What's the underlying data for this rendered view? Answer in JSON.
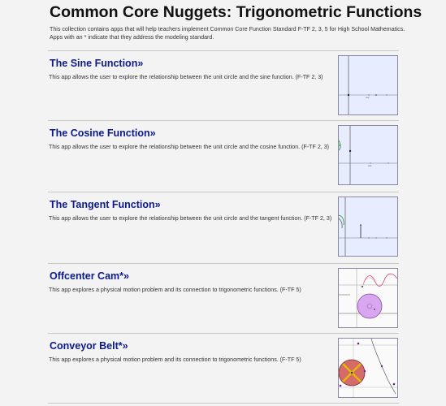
{
  "header": {
    "title": "Common Core Nuggets: Trigonometric Functions",
    "intro": "This collection contains apps that will help teachers implement Common Core Function Standard F-TF 2, 3, 5 for High School Mathematics. Apps with an * indicate that they address the modeling standard."
  },
  "items": [
    {
      "title": "The Sine Function",
      "arrow": "»",
      "description": "This app allows the user to explore the relationship between the unit circle and the sine function. (F-TF 2, 3)"
    },
    {
      "title": "The Cosine Function",
      "arrow": "»",
      "description": "This app allows the user to explore the relationship between the unit circle and the cosine function. (F-TF 2, 3)"
    },
    {
      "title": "The Tangent Function",
      "arrow": "»",
      "description": "This app allows the user to explore the relationship between the unit circle and the tangent function. (F-TF 2, 3)"
    },
    {
      "title": "Offcenter Cam*",
      "arrow": "»",
      "description": "This app explores a physical motion problem and its connection to trigonometric functions. (F-TF 5)"
    },
    {
      "title": "Conveyor Belt*",
      "arrow": "»",
      "description": "This app explores a physical motion problem and its connection to trigonometric functions. (F-TF 5)"
    }
  ],
  "colors": {
    "link": "#0d1a8c",
    "thumb_bg": "#e8ecff",
    "background": "#f3f3f3"
  }
}
